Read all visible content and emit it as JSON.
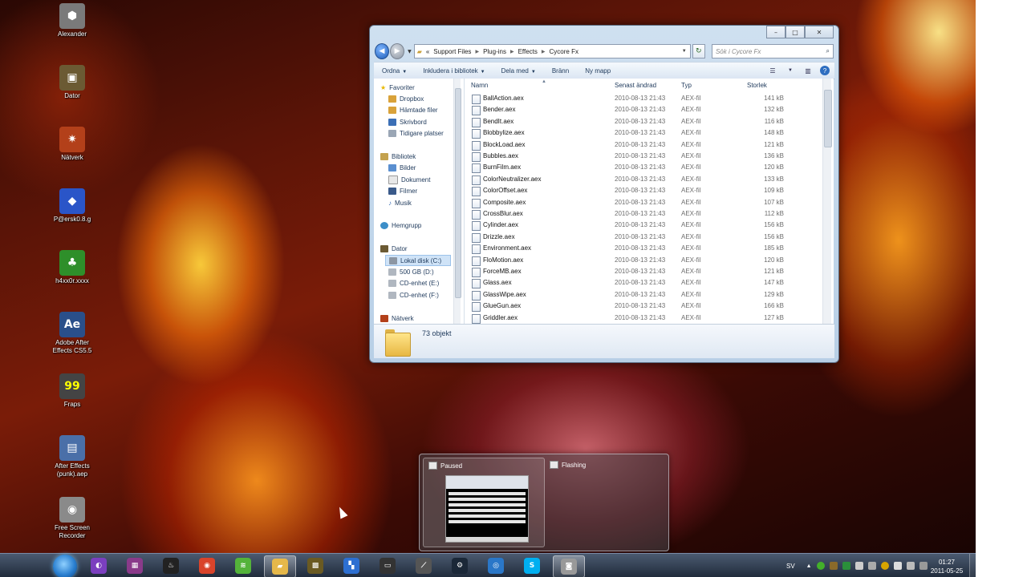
{
  "desktop": {
    "icons": [
      {
        "label": "Alexander",
        "icon": "user-badge-icon",
        "color": "#7a7a7a"
      },
      {
        "label": "Dator",
        "icon": "computer-icon",
        "color": "#6b5a33"
      },
      {
        "label": "Nätverk",
        "icon": "network-icon",
        "color": "#b3401a"
      },
      {
        "label": "P@ersk0.8.g",
        "icon": "diamond-icon",
        "color": "#2a55c8"
      },
      {
        "label": "h4xx0r.xxxx",
        "icon": "tree-icon",
        "color": "#2e8f2a"
      },
      {
        "label": "Adobe After\nEffects CS5.5",
        "icon": "after-effects-icon",
        "color": "#2a4f8a"
      },
      {
        "label": "Fraps",
        "icon": "fraps-icon",
        "color": "#444444"
      },
      {
        "label": "After Effects\n(punk).aep",
        "icon": "aep-file-icon",
        "color": "#4a6fa8"
      },
      {
        "label": "Free Screen\nRecorder",
        "icon": "camera-icon",
        "color": "#8a8a8a"
      }
    ]
  },
  "explorer": {
    "title_buttons": {
      "minimize": "–",
      "maximize": "□",
      "close": "✕"
    },
    "address": {
      "lead": "«",
      "crumbs": [
        "Support Files",
        "Plug-ins",
        "Effects",
        "Cycore Fx"
      ]
    },
    "search_placeholder": "Sök i Cycore Fx",
    "commands": [
      "Ordna",
      "Inkludera i bibliotek",
      "Dela med",
      "Bränn",
      "Ny mapp"
    ],
    "nav": {
      "favorites_header": "Favoriter",
      "favorites": [
        "Dropbox",
        "Hämtade filer",
        "Skrivbord",
        "Tidigare platser"
      ],
      "libraries_header": "Bibliotek",
      "libraries": [
        "Bilder",
        "Dokument",
        "Filmer",
        "Musik"
      ],
      "homegroup": "Hemgrupp",
      "computer_header": "Dator",
      "drives": [
        "Lokal disk (C:)",
        "500 GB (D:)",
        "CD-enhet (E:)",
        "CD-enhet (F:)"
      ],
      "network": "Nätverk"
    },
    "columns": {
      "name": "Namn",
      "date": "Senast ändrad",
      "type": "Typ",
      "size": "Storlek"
    },
    "files": [
      {
        "name": "BallAction.aex",
        "date": "2010-08-13 21:43",
        "type": "AEX-fil",
        "size": "141 kB"
      },
      {
        "name": "Bender.aex",
        "date": "2010-08-13 21:43",
        "type": "AEX-fil",
        "size": "132 kB"
      },
      {
        "name": "BendIt.aex",
        "date": "2010-08-13 21:43",
        "type": "AEX-fil",
        "size": "116 kB"
      },
      {
        "name": "Blobbylize.aex",
        "date": "2010-08-13 21:43",
        "type": "AEX-fil",
        "size": "148 kB"
      },
      {
        "name": "BlockLoad.aex",
        "date": "2010-08-13 21:43",
        "type": "AEX-fil",
        "size": "121 kB"
      },
      {
        "name": "Bubbles.aex",
        "date": "2010-08-13 21:43",
        "type": "AEX-fil",
        "size": "136 kB"
      },
      {
        "name": "BurnFilm.aex",
        "date": "2010-08-13 21:43",
        "type": "AEX-fil",
        "size": "120 kB"
      },
      {
        "name": "ColorNeutralizer.aex",
        "date": "2010-08-13 21:43",
        "type": "AEX-fil",
        "size": "133 kB"
      },
      {
        "name": "ColorOffset.aex",
        "date": "2010-08-13 21:43",
        "type": "AEX-fil",
        "size": "109 kB"
      },
      {
        "name": "Composite.aex",
        "date": "2010-08-13 21:43",
        "type": "AEX-fil",
        "size": "107 kB"
      },
      {
        "name": "CrossBlur.aex",
        "date": "2010-08-13 21:43",
        "type": "AEX-fil",
        "size": "112 kB"
      },
      {
        "name": "Cylinder.aex",
        "date": "2010-08-13 21:43",
        "type": "AEX-fil",
        "size": "156 kB"
      },
      {
        "name": "Drizzle.aex",
        "date": "2010-08-13 21:43",
        "type": "AEX-fil",
        "size": "156 kB"
      },
      {
        "name": "Environment.aex",
        "date": "2010-08-13 21:43",
        "type": "AEX-fil",
        "size": "185 kB"
      },
      {
        "name": "FloMotion.aex",
        "date": "2010-08-13 21:43",
        "type": "AEX-fil",
        "size": "120 kB"
      },
      {
        "name": "ForceMB.aex",
        "date": "2010-08-13 21:43",
        "type": "AEX-fil",
        "size": "121 kB"
      },
      {
        "name": "Glass.aex",
        "date": "2010-08-13 21:43",
        "type": "AEX-fil",
        "size": "147 kB"
      },
      {
        "name": "GlassWipe.aex",
        "date": "2010-08-13 21:43",
        "type": "AEX-fil",
        "size": "129 kB"
      },
      {
        "name": "GlueGun.aex",
        "date": "2010-08-13 21:43",
        "type": "AEX-fil",
        "size": "166 kB"
      },
      {
        "name": "Griddler.aex",
        "date": "2010-08-13 21:43",
        "type": "AEX-fil",
        "size": "127 kB"
      }
    ],
    "status_count": "73 objekt"
  },
  "thumbnails": [
    {
      "title": "Paused"
    },
    {
      "title": "Flashing"
    }
  ],
  "taskbar": {
    "apps": [
      {
        "icon": "firefox-icon",
        "color": "#7b3fbf"
      },
      {
        "icon": "winrar-icon",
        "color": "#8a3a8a"
      },
      {
        "icon": "steam-tool-icon",
        "color": "#222222"
      },
      {
        "icon": "chrome-icon",
        "color": "#d9442b"
      },
      {
        "icon": "spotify-icon",
        "color": "#54b33a"
      },
      {
        "icon": "explorer-folder-icon",
        "color": "#e6b84a"
      },
      {
        "icon": "game-icon",
        "color": "#6a5a22"
      },
      {
        "icon": "network-app-icon",
        "color": "#2d6fd1"
      },
      {
        "icon": "terminal-icon",
        "color": "#333333"
      },
      {
        "icon": "fl-studio-icon",
        "color": "#555555"
      },
      {
        "icon": "steam-icon",
        "color": "#1b2838"
      },
      {
        "icon": "media-icon",
        "color": "#2a77c8"
      },
      {
        "icon": "skype-icon",
        "color": "#00aff0"
      },
      {
        "icon": "screen-recorder-icon",
        "color": "#999999"
      }
    ],
    "language": "SV",
    "time": "01:27",
    "date": "2011-05-25"
  }
}
